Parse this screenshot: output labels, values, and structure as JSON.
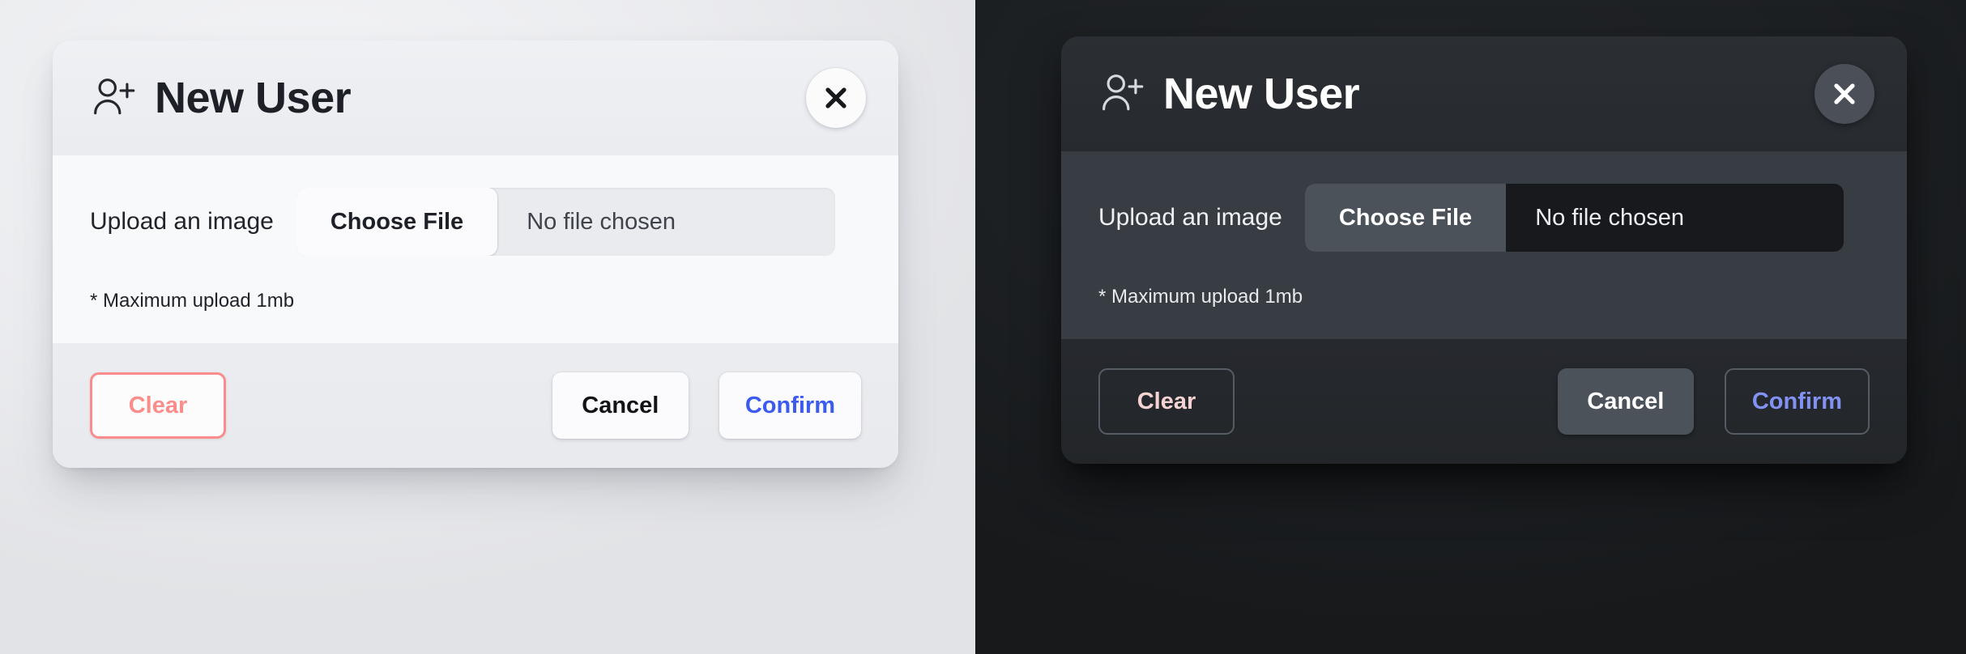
{
  "panes": [
    {
      "theme": "light",
      "modal": {
        "icon": "user-plus-icon",
        "title": "New User",
        "close_label": "close-icon",
        "upload_label": "Upload an image",
        "choose_file_label": "Choose File",
        "file_status": "No file chosen",
        "note": "* Maximum upload 1mb",
        "clear_label": "Clear",
        "cancel_label": "Cancel",
        "confirm_label": "Confirm"
      }
    },
    {
      "theme": "dark",
      "modal": {
        "icon": "user-plus-icon",
        "title": "New User",
        "close_label": "close-icon",
        "upload_label": "Upload an image",
        "choose_file_label": "Choose File",
        "file_status": "No file chosen",
        "note": "* Maximum upload 1mb",
        "clear_label": "Clear",
        "cancel_label": "Cancel",
        "confirm_label": "Confirm"
      }
    }
  ],
  "colors": {
    "light_bg": "#ebecef",
    "light_modal_header": "#eaecf0",
    "light_modal_body": "#f8f9fb",
    "light_modal_footer": "#e8eaee",
    "light_title": "#1d2026",
    "light_clear_accent": "#fb8c8c",
    "light_confirm_accent": "#3b5bee",
    "dark_bg": "#1d2023",
    "dark_modal_header": "#272b30",
    "dark_modal_body": "#383d44",
    "dark_modal_footer": "#26292e",
    "dark_title": "#ffffff",
    "dark_clear_accent": "#f6d3d3",
    "dark_confirm_accent": "#8292f2",
    "dark_close_circle": "#4b5058",
    "dark_choose_file": "#4c525a",
    "dark_file_field": "#17191c"
  }
}
